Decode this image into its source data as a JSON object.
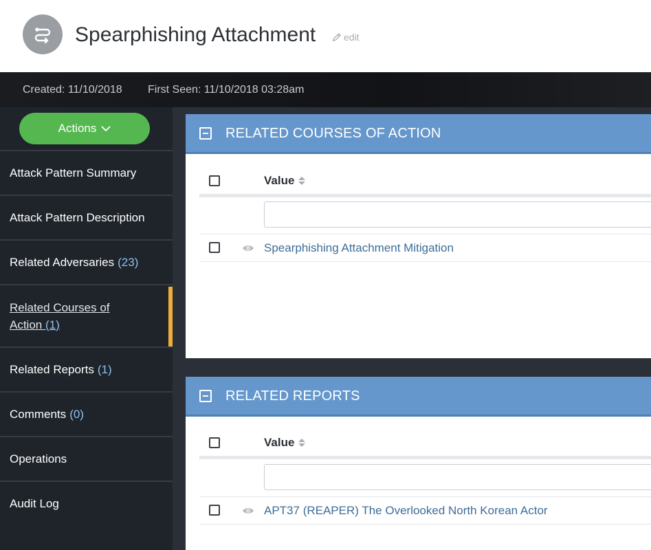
{
  "header": {
    "title": "Spearphishing Attachment",
    "edit_label": "edit",
    "created": "Created: 11/10/2018",
    "first_seen": "First Seen: 11/10/2018 03:28am"
  },
  "sidebar": {
    "actions_label": "Actions",
    "items": [
      {
        "label": "Attack Pattern Summary",
        "count": ""
      },
      {
        "label": "Attack Pattern Description",
        "count": ""
      },
      {
        "label": "Related Adversaries",
        "count": "(23)"
      },
      {
        "label": "Related Courses of Action",
        "count": "(1)"
      },
      {
        "label": "Related Reports",
        "count": "(1)"
      },
      {
        "label": "Comments",
        "count": "(0)"
      },
      {
        "label": "Operations",
        "count": ""
      },
      {
        "label": "Audit Log",
        "count": ""
      }
    ]
  },
  "panels": [
    {
      "title": "RELATED COURSES OF ACTION",
      "column": "Value",
      "filter_value": "",
      "rows": [
        "Spearphishing Attachment Mitigation"
      ]
    },
    {
      "title": "RELATED REPORTS",
      "column": "Value",
      "filter_value": "",
      "rows": [
        "APT37 (REAPER) The Overlooked North Korean Actor"
      ]
    }
  ],
  "colors": {
    "accent_blue": "#6597cd",
    "actions_green": "#55b74f",
    "active_marker": "#f0ad38",
    "count_blue": "#8fc1ec",
    "link_blue": "#3c6d98"
  }
}
